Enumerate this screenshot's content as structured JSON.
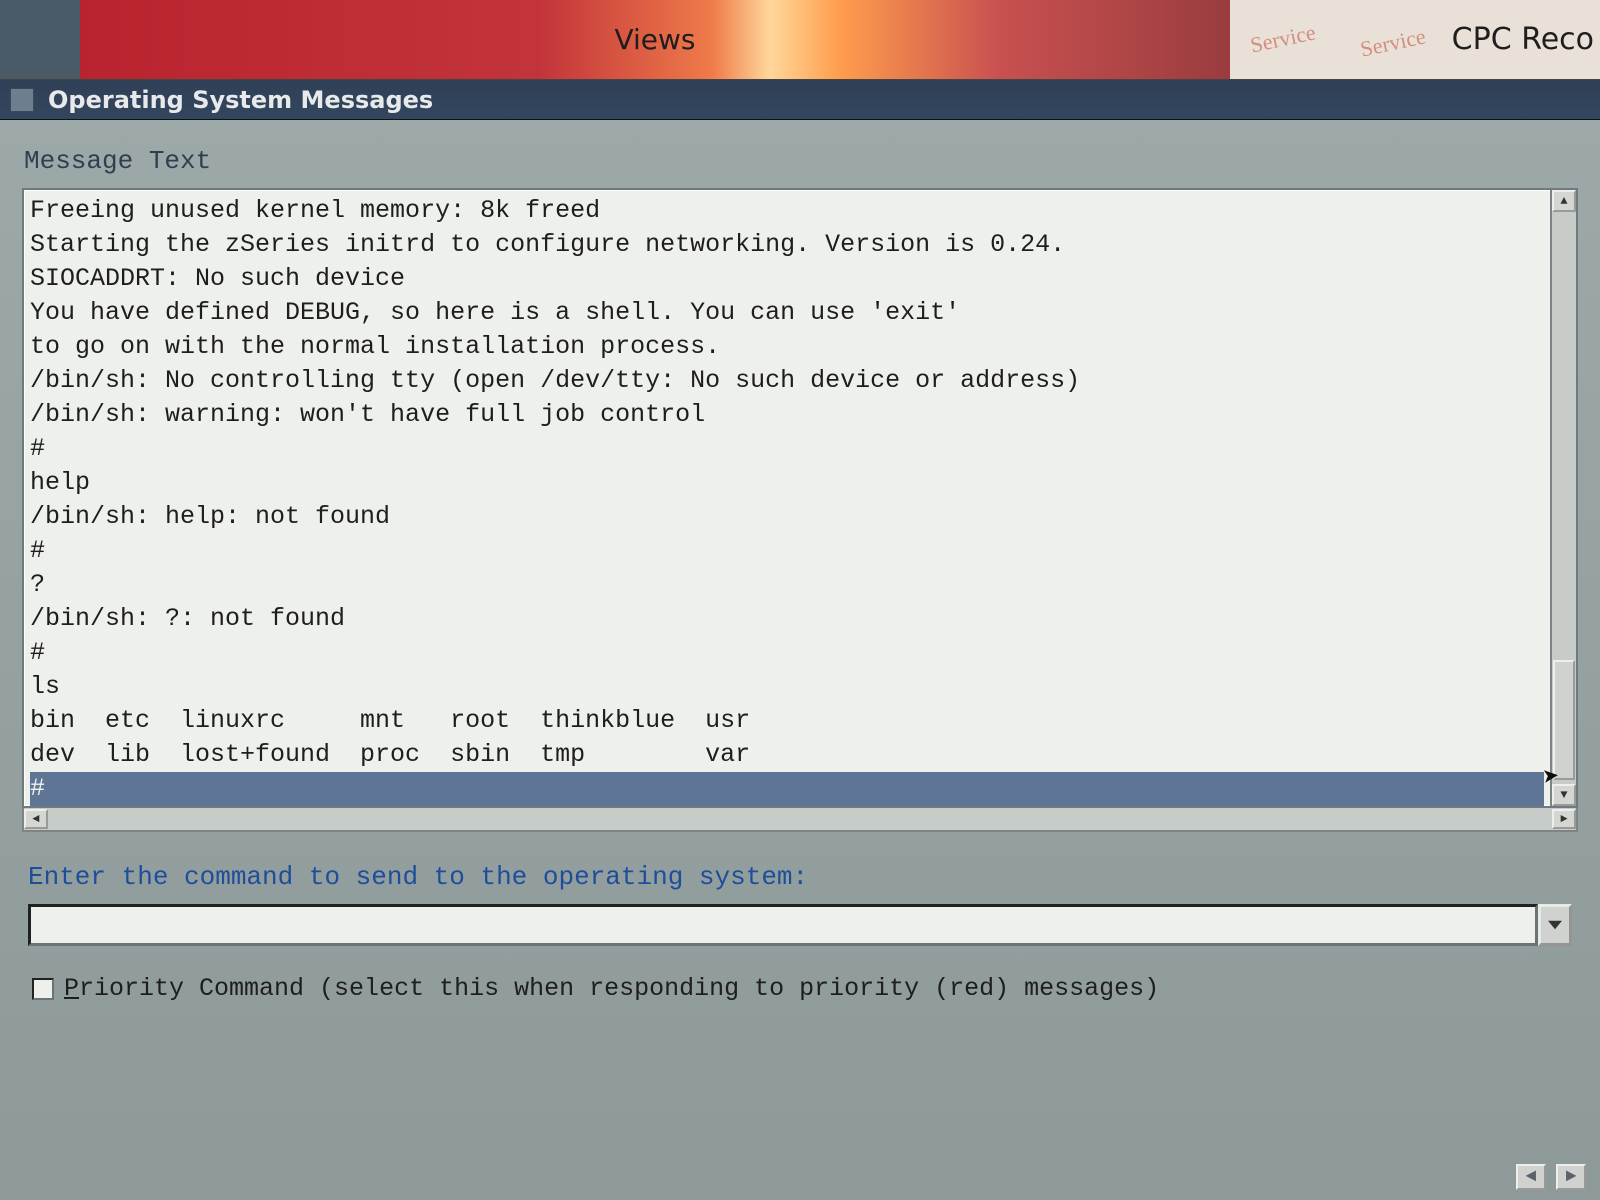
{
  "top": {
    "views_label": "Views",
    "right_label": "CPC Reco",
    "scribble_a": "Service",
    "scribble_b": "Service"
  },
  "window": {
    "title": "Operating System Messages"
  },
  "section": {
    "message_text_label": "Message Text"
  },
  "messages": {
    "lines": [
      "Freeing unused kernel memory: 8k freed",
      "Starting the zSeries initrd to configure networking. Version is 0.24.",
      "SIOCADDRT: No such device",
      "You have defined DEBUG, so here is a shell. You can use 'exit'",
      "to go on with the normal installation process.",
      "/bin/sh: No controlling tty (open /dev/tty: No such device or address)",
      "/bin/sh: warning: won't have full job control",
      "#",
      "help",
      "/bin/sh: help: not found",
      "#",
      "?",
      "/bin/sh: ?: not found",
      "#",
      "ls",
      "bin  etc  linuxrc     mnt   root  thinkblue  usr",
      "dev  lib  lost+found  proc  sbin  tmp        var"
    ],
    "selected_line": "#"
  },
  "command": {
    "label": "Enter the command to send to the operating system:",
    "value": ""
  },
  "priority": {
    "prefix_underlined": "P",
    "label_rest": "riority Command (select this when responding to priority (red) messages)"
  }
}
